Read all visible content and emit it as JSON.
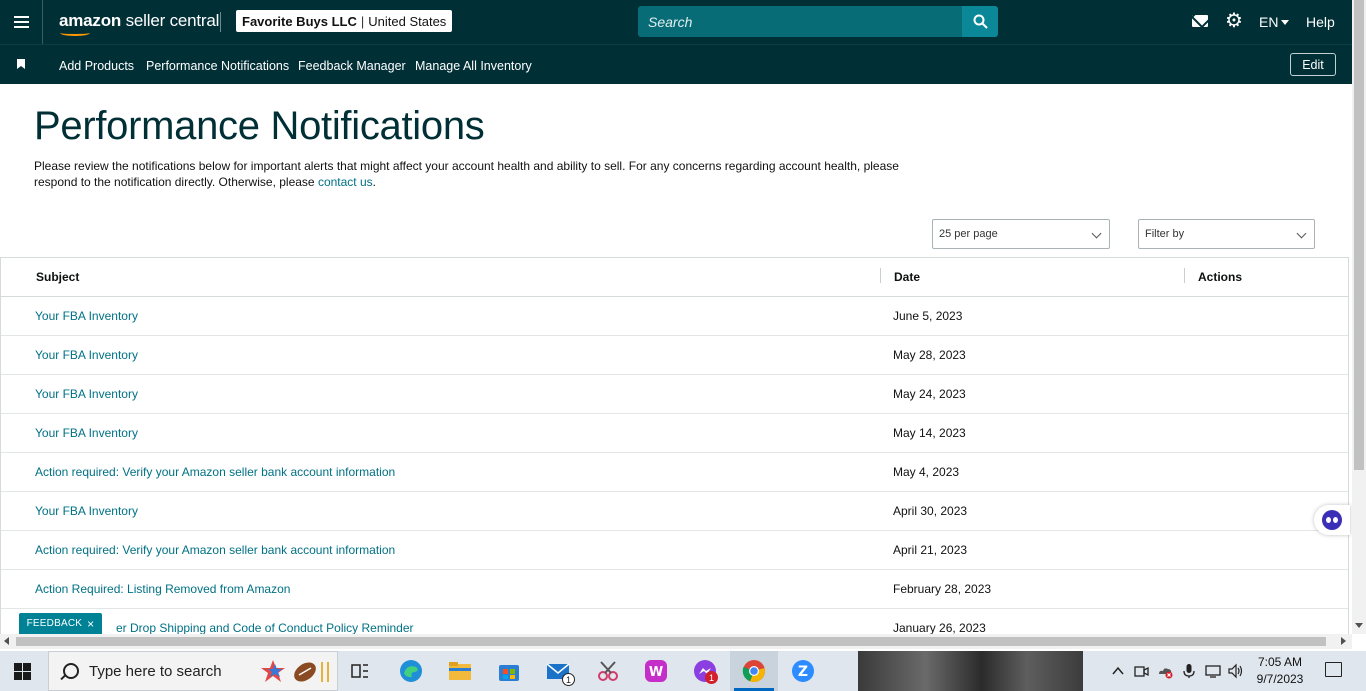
{
  "header": {
    "logo_brand": "amazon",
    "logo_suffix": " seller central",
    "account_name": "Favorite Buys LLC",
    "account_separator": "|",
    "account_region": "United States",
    "search_placeholder": "Search",
    "language": "EN",
    "help_label": "Help"
  },
  "nav": {
    "items": [
      {
        "label": "Add Products"
      },
      {
        "label": "Performance Notifications"
      },
      {
        "label": "Feedback Manager"
      },
      {
        "label": "Manage All Inventory"
      }
    ],
    "edit_label": "Edit"
  },
  "page": {
    "title": "Performance Notifications",
    "intro_text": "Please review the notifications below for important alerts that might affect your account health and ability to sell. For any concerns regarding account health, please respond to the notification directly. Otherwise, please ",
    "intro_link": "contact us",
    "intro_end": ".",
    "per_page_value": "25 per page",
    "filter_placeholder": "Filter by"
  },
  "table": {
    "columns": [
      "Subject",
      "Date",
      "Actions"
    ],
    "rows": [
      {
        "subject": "Your FBA Inventory",
        "date": "June 5, 2023"
      },
      {
        "subject": "Your FBA Inventory",
        "date": "May 28, 2023"
      },
      {
        "subject": "Your FBA Inventory",
        "date": "May 24, 2023"
      },
      {
        "subject": "Your FBA Inventory",
        "date": "May 14, 2023"
      },
      {
        "subject": "Action required: Verify your Amazon seller bank account information",
        "date": "May 4, 2023"
      },
      {
        "subject": "Your FBA Inventory",
        "date": "April 30, 2023"
      },
      {
        "subject": "Action required: Verify your Amazon seller bank account information",
        "date": "April 21, 2023"
      },
      {
        "subject": "Action Required: Listing Removed from Amazon",
        "date": "February 28, 2023"
      },
      {
        "subject": "er Drop Shipping and Code of Conduct Policy Reminder",
        "date": "January 26, 2023"
      }
    ]
  },
  "feedback": {
    "label": "FEEDBACK",
    "close": "×"
  },
  "taskbar": {
    "search_text": "Type here to search",
    "time": "7:05 AM",
    "date": "9/7/2023",
    "mail_badge": "1",
    "messenger_badge": "1"
  },
  "colors": {
    "header_bg": "#002f36",
    "link": "#007185",
    "search_bg": "#086c77",
    "feedback_bg": "#008296"
  },
  "icons": [
    "menu-icon",
    "mail-icon",
    "gear-icon",
    "search-icon",
    "bookmark-icon",
    "chevron-down-icon",
    "chat-assistant-icon",
    "windows-start-icon"
  ]
}
